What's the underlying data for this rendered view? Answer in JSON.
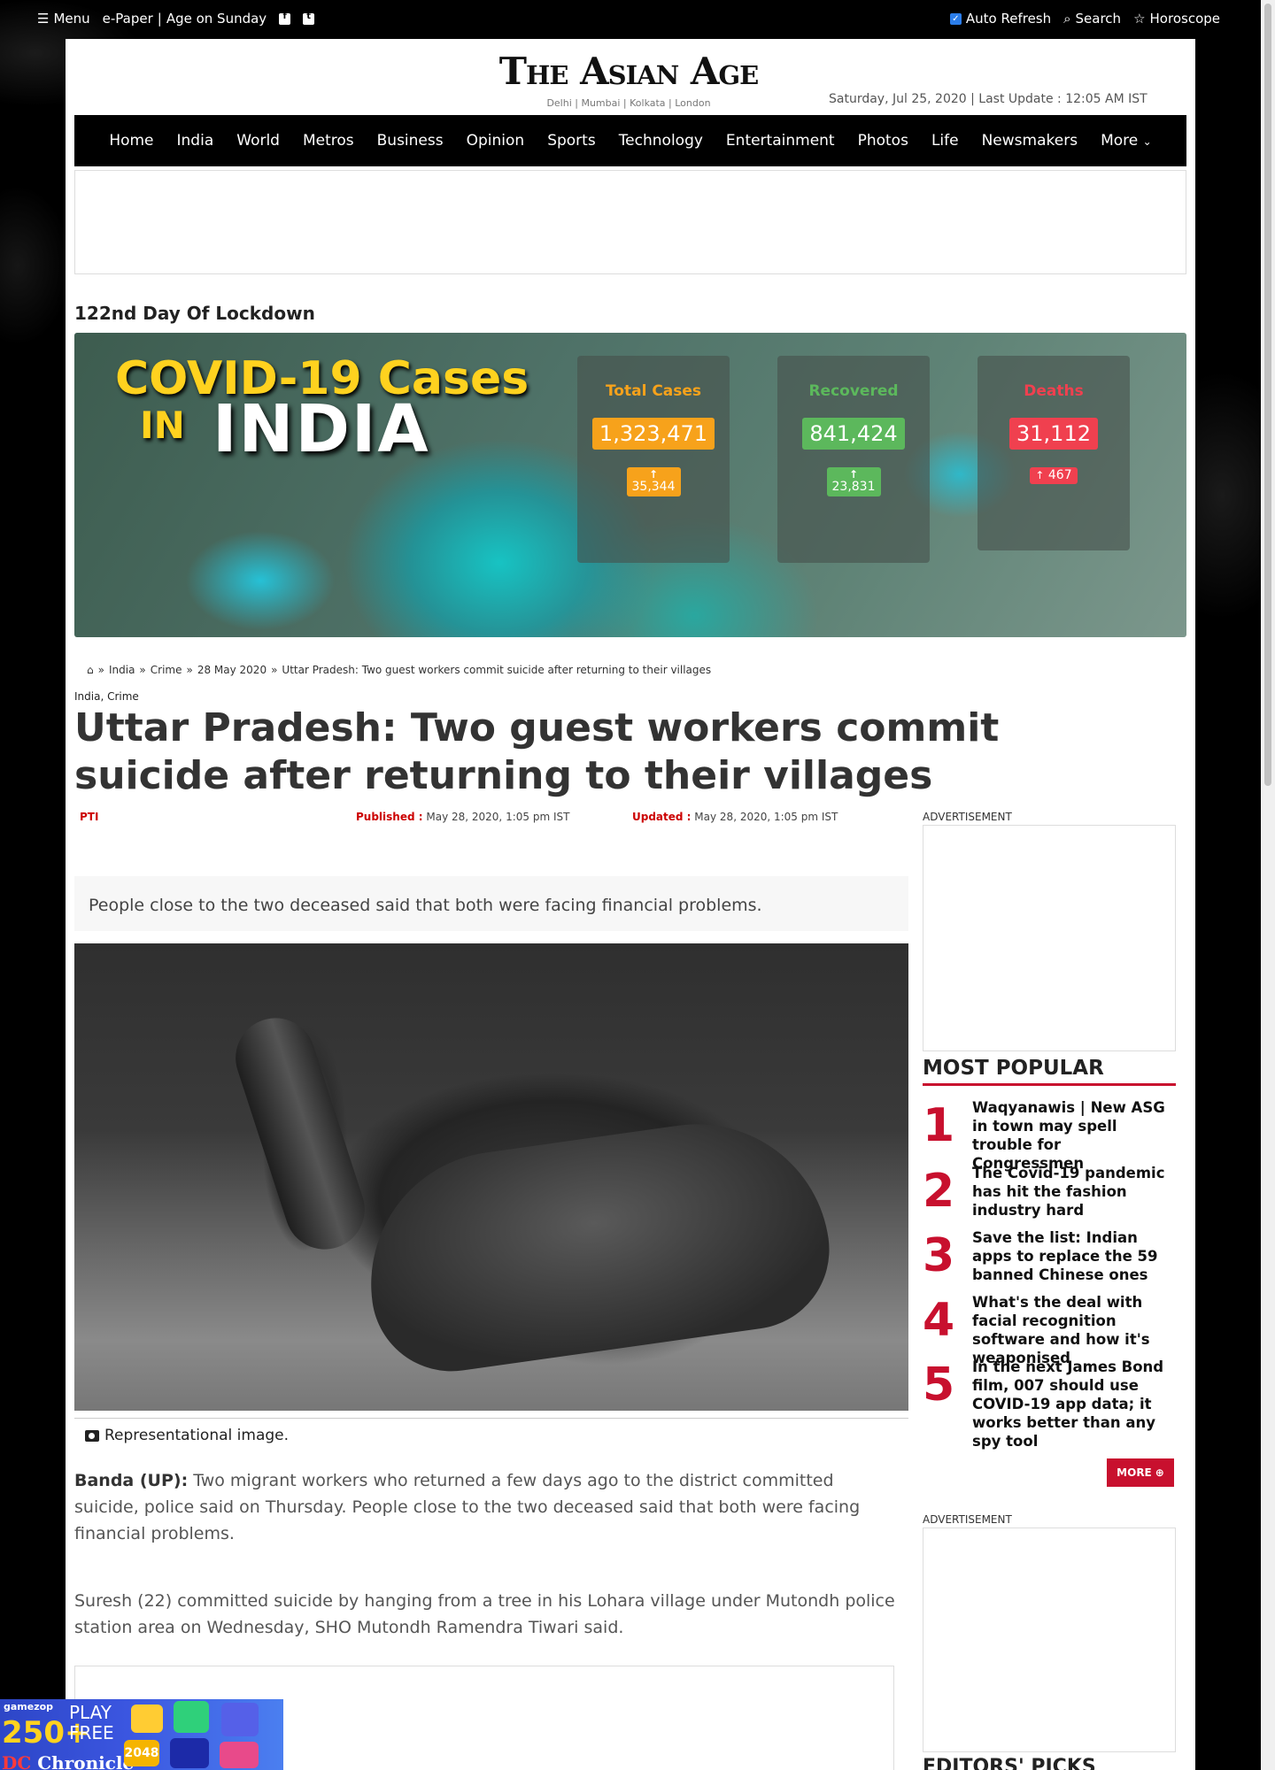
{
  "topbar": {
    "menu_label": "Menu",
    "epaper_label": "e-Paper",
    "separator": "|",
    "age_on_sunday_label": "Age on Sunday",
    "facebook_icon": "f",
    "twitter_icon": "t",
    "auto_refresh_label": "Auto Refresh",
    "auto_refresh_checked": true,
    "search_label": "Search",
    "horoscope_label": "Horoscope"
  },
  "masthead": {
    "logo_text": "The Asian Age",
    "editions": "Delhi | Mumbai | Kolkata | London",
    "dateline": "Saturday, Jul 25, 2020 | Last Update : 12:05 AM IST"
  },
  "nav": {
    "items": [
      "Home",
      "India",
      "World",
      "Metros",
      "Business",
      "Opinion",
      "Sports",
      "Technology",
      "Entertainment",
      "Photos",
      "Life",
      "Newsmakers",
      "More"
    ]
  },
  "lockdown": {
    "title": "122nd Day Of Lockdown"
  },
  "covid": {
    "title_line1": "COVID-19 Cases",
    "title_in": "IN",
    "title_country": "INDIA",
    "stats": [
      {
        "label": "Total Cases",
        "value": "1,323,471",
        "delta": "35,344",
        "color": "#f7a21b"
      },
      {
        "label": "Recovered",
        "value": "841,424",
        "delta": "23,831",
        "color": "#5cb85c"
      },
      {
        "label": "Deaths",
        "value": "31,112",
        "delta": "467",
        "color": "#f0404f"
      }
    ]
  },
  "breadcrumb": {
    "items": [
      "India",
      "Crime",
      "28 May 2020",
      "Uttar Pradesh: Two guest workers commit suicide after returning to their villages"
    ]
  },
  "article": {
    "categories": "India, Crime",
    "headline": "Uttar Pradesh: Two guest workers commit suicide after returning to their villages",
    "author": "PTI",
    "published_label": "Published :",
    "published_value": "May 28, 2020, 1:05 pm IST",
    "updated_label": "Updated :",
    "updated_value": "May 28, 2020, 1:05 pm IST",
    "summary": "People close to the two deceased said that both were facing financial problems.",
    "image_caption": "Representational image.",
    "dateline": "Banda (UP):",
    "para1": "Two migrant workers who returned a few days ago to the district committed suicide, police said on Thursday. People close to the two deceased said that both were facing financial problems.",
    "para2": "Suresh (22) committed suicide by hanging from a tree in his Lohara village under Mutondh police station area on Wednesday, SHO Mutondh Ramendra Tiwari said."
  },
  "sidebar": {
    "ad_label": "ADVERTISEMENT",
    "most_popular_title": "MOST POPULAR",
    "most_popular": [
      {
        "rank": "1",
        "title": "Waqyanawis | New ASG in town may spell trouble for Congressmen"
      },
      {
        "rank": "2",
        "title": "The Covid-19 pandemic has hit the fashion industry hard"
      },
      {
        "rank": "3",
        "title": "Save the list: Indian apps to replace the 59 banned Chinese ones"
      },
      {
        "rank": "4",
        "title": "What's the deal with facial recognition software and how it's weaponised"
      },
      {
        "rank": "5",
        "title": "In the next James Bond film, 007 should use COVID-19 app data; it works better than any spy tool"
      }
    ],
    "more_label": "MORE",
    "editors_picks_title": "EDITORS' PICKS"
  },
  "promo": {
    "brand": "gamezop",
    "count": "250+",
    "play": "PLAY",
    "free": "FREE",
    "dc": "DC",
    "chronicle": "Chronicle",
    "tile_text": "2048"
  }
}
